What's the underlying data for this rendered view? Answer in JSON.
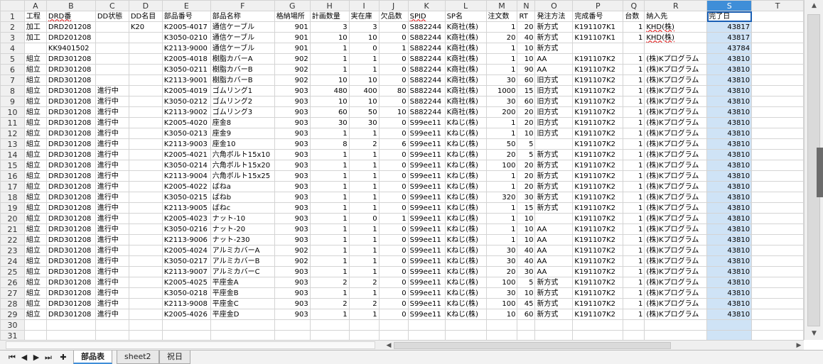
{
  "columns": [
    "A",
    "B",
    "C",
    "D",
    "E",
    "F",
    "G",
    "H",
    "I",
    "J",
    "K",
    "L",
    "M",
    "N",
    "O",
    "P",
    "Q",
    "R",
    "S",
    "T"
  ],
  "selected_column": "S",
  "header_row": [
    "工程",
    "DRD番",
    "DD状態",
    "DD名目",
    "部品番号",
    "部品名称",
    "格納場所",
    "計画数量",
    "実在庫",
    "欠品数",
    "SPID",
    "SP名",
    "注文数",
    "RT",
    "発注方法",
    "完成番号",
    "台数",
    "納入先",
    "完了日",
    ""
  ],
  "rows": [
    [
      "加工",
      "DRD201208",
      "",
      "K20",
      "K2005-4017",
      "通信ケーブル",
      "901",
      "3",
      "3",
      "0",
      "S882244",
      "K商社(株)",
      "1",
      "20",
      "新方式",
      "K191107K1",
      "1",
      "KHD(株)",
      "43817",
      ""
    ],
    [
      "加工",
      "DRD201208",
      "",
      "",
      "K3050-0210",
      "通信ケーブル",
      "901",
      "10",
      "10",
      "0",
      "S882244",
      "K商社(株)",
      "20",
      "40",
      "新方式",
      "K191107K1",
      "1",
      "KHD(株)",
      "43817",
      ""
    ],
    [
      "",
      "KK9401502",
      "",
      "",
      "K2113-9000",
      "通信ケーブル",
      "901",
      "1",
      "0",
      "1",
      "S882244",
      "K商社(株)",
      "1",
      "10",
      "新方式",
      "",
      "",
      "",
      "43784",
      ""
    ],
    [
      "組立",
      "DRD301208",
      "",
      "",
      "K2005-4018",
      "樹脂カバーA",
      "902",
      "1",
      "1",
      "0",
      "S882244",
      "K商社(株)",
      "1",
      "10",
      "AA",
      "K191107K2",
      "1",
      "(株)Kプログラム",
      "43810",
      ""
    ],
    [
      "組立",
      "DRD301208",
      "",
      "",
      "K3050-0211",
      "樹脂カバーB",
      "902",
      "1",
      "1",
      "0",
      "S882244",
      "K商社(株)",
      "1",
      "90",
      "AA",
      "K191107K2",
      "1",
      "(株)Kプログラム",
      "43810",
      ""
    ],
    [
      "組立",
      "DRD301208",
      "",
      "",
      "K2113-9001",
      "樹脂カバーB",
      "902",
      "10",
      "10",
      "0",
      "S882244",
      "K商社(株)",
      "30",
      "60",
      "旧方式",
      "K191107K2",
      "1",
      "(株)Kプログラム",
      "43810",
      ""
    ],
    [
      "組立",
      "DRD301208",
      "進行中",
      "",
      "K2005-4019",
      "ゴムリング1",
      "903",
      "480",
      "400",
      "80",
      "S882244",
      "K商社(株)",
      "1000",
      "15",
      "旧方式",
      "K191107K2",
      "1",
      "(株)Kプログラム",
      "43810",
      ""
    ],
    [
      "組立",
      "DRD301208",
      "進行中",
      "",
      "K3050-0212",
      "ゴムリング2",
      "903",
      "10",
      "10",
      "0",
      "S882244",
      "K商社(株)",
      "30",
      "60",
      "旧方式",
      "K191107K2",
      "1",
      "(株)Kプログラム",
      "43810",
      ""
    ],
    [
      "組立",
      "DRD301208",
      "進行中",
      "",
      "K2113-9002",
      "ゴムリング3",
      "903",
      "60",
      "50",
      "10",
      "S882244",
      "K商社(株)",
      "200",
      "20",
      "旧方式",
      "K191107K2",
      "1",
      "(株)Kプログラム",
      "43810",
      ""
    ],
    [
      "組立",
      "DRD301208",
      "進行中",
      "",
      "K2005-4020",
      "座金8",
      "903",
      "30",
      "30",
      "0",
      "S99ee11",
      "Kねじ(株)",
      "1",
      "20",
      "旧方式",
      "K191107K2",
      "1",
      "(株)Kプログラム",
      "43810",
      ""
    ],
    [
      "組立",
      "DRD301208",
      "進行中",
      "",
      "K3050-0213",
      "座金9",
      "903",
      "1",
      "1",
      "0",
      "S99ee11",
      "Kねじ(株)",
      "1",
      "10",
      "旧方式",
      "K191107K2",
      "1",
      "(株)Kプログラム",
      "43810",
      ""
    ],
    [
      "組立",
      "DRD301208",
      "進行中",
      "",
      "K2113-9003",
      "座金10",
      "903",
      "8",
      "2",
      "6",
      "S99ee11",
      "Kねじ(株)",
      "50",
      "5",
      "",
      "K191107K2",
      "1",
      "(株)Kプログラム",
      "43810",
      ""
    ],
    [
      "組立",
      "DRD301208",
      "進行中",
      "",
      "K2005-4021",
      "六角ボルト15x10",
      "903",
      "1",
      "1",
      "0",
      "S99ee11",
      "Kねじ(株)",
      "20",
      "5",
      "新方式",
      "K191107K2",
      "1",
      "(株)Kプログラム",
      "43810",
      ""
    ],
    [
      "組立",
      "DRD301208",
      "進行中",
      "",
      "K3050-0214",
      "六角ボルト15x20",
      "903",
      "1",
      "1",
      "0",
      "S99ee11",
      "Kねじ(株)",
      "100",
      "20",
      "新方式",
      "K191107K2",
      "1",
      "(株)Kプログラム",
      "43810",
      ""
    ],
    [
      "組立",
      "DRD301208",
      "進行中",
      "",
      "K2113-9004",
      "六角ボルト15x25",
      "903",
      "1",
      "1",
      "0",
      "S99ee11",
      "Kねじ(株)",
      "1",
      "20",
      "新方式",
      "K191107K2",
      "1",
      "(株)Kプログラム",
      "43810",
      ""
    ],
    [
      "組立",
      "DRD301208",
      "進行中",
      "",
      "K2005-4022",
      "ばねa",
      "903",
      "1",
      "1",
      "0",
      "S99ee11",
      "Kねじ(株)",
      "1",
      "20",
      "新方式",
      "K191107K2",
      "1",
      "(株)Kプログラム",
      "43810",
      ""
    ],
    [
      "組立",
      "DRD301208",
      "進行中",
      "",
      "K3050-0215",
      "ばねb",
      "903",
      "1",
      "1",
      "0",
      "S99ee11",
      "Kねじ(株)",
      "320",
      "30",
      "新方式",
      "K191107K2",
      "1",
      "(株)Kプログラム",
      "43810",
      ""
    ],
    [
      "組立",
      "DRD301208",
      "進行中",
      "",
      "K2113-9005",
      "ばねc",
      "903",
      "1",
      "1",
      "0",
      "S99ee11",
      "Kねじ(株)",
      "1",
      "15",
      "新方式",
      "K191107K2",
      "1",
      "(株)Kプログラム",
      "43810",
      ""
    ],
    [
      "組立",
      "DRD301208",
      "進行中",
      "",
      "K2005-4023",
      "ナット-10",
      "903",
      "1",
      "0",
      "1",
      "S99ee11",
      "Kねじ(株)",
      "1",
      "10",
      "",
      "K191107K2",
      "1",
      "(株)Kプログラム",
      "43810",
      ""
    ],
    [
      "組立",
      "DRD301208",
      "進行中",
      "",
      "K3050-0216",
      "ナット-20",
      "903",
      "1",
      "1",
      "0",
      "S99ee11",
      "Kねじ(株)",
      "1",
      "10",
      "AA",
      "K191107K2",
      "1",
      "(株)Kプログラム",
      "43810",
      ""
    ],
    [
      "組立",
      "DRD301208",
      "進行中",
      "",
      "K2113-9006",
      "ナット-230",
      "903",
      "1",
      "1",
      "0",
      "S99ee11",
      "Kねじ(株)",
      "1",
      "10",
      "AA",
      "K191107K2",
      "1",
      "(株)Kプログラム",
      "43810",
      ""
    ],
    [
      "組立",
      "DRD301208",
      "進行中",
      "",
      "K2005-4024",
      "アルミカバーA",
      "902",
      "1",
      "1",
      "0",
      "S99ee11",
      "Kねじ(株)",
      "30",
      "40",
      "AA",
      "K191107K2",
      "1",
      "(株)Kプログラム",
      "43810",
      ""
    ],
    [
      "組立",
      "DRD301208",
      "進行中",
      "",
      "K3050-0217",
      "アルミカバーB",
      "902",
      "1",
      "1",
      "0",
      "S99ee11",
      "Kねじ(株)",
      "30",
      "40",
      "AA",
      "K191107K2",
      "1",
      "(株)Kプログラム",
      "43810",
      ""
    ],
    [
      "組立",
      "DRD301208",
      "進行中",
      "",
      "K2113-9007",
      "アルミカバーC",
      "903",
      "1",
      "1",
      "0",
      "S99ee11",
      "Kねじ(株)",
      "20",
      "30",
      "AA",
      "K191107K2",
      "1",
      "(株)Kプログラム",
      "43810",
      ""
    ],
    [
      "組立",
      "DRD301208",
      "進行中",
      "",
      "K2005-4025",
      "平座金A",
      "903",
      "2",
      "2",
      "0",
      "S99ee11",
      "Kねじ(株)",
      "100",
      "5",
      "新方式",
      "K191107K2",
      "1",
      "(株)Kプログラム",
      "43810",
      ""
    ],
    [
      "組立",
      "DRD301208",
      "進行中",
      "",
      "K3050-0218",
      "平座金B",
      "903",
      "1",
      "1",
      "0",
      "S99ee11",
      "Kねじ(株)",
      "30",
      "10",
      "新方式",
      "K191107K2",
      "1",
      "(株)Kプログラム",
      "43810",
      ""
    ],
    [
      "組立",
      "DRD301208",
      "進行中",
      "",
      "K2113-9008",
      "平座金C",
      "903",
      "2",
      "2",
      "0",
      "S99ee11",
      "Kねじ(株)",
      "100",
      "45",
      "新方式",
      "K191107K2",
      "1",
      "(株)Kプログラム",
      "43810",
      ""
    ],
    [
      "組立",
      "DRD301208",
      "進行中",
      "",
      "K2005-4026",
      "平座金D",
      "903",
      "1",
      "1",
      "0",
      "S99ee11",
      "Kねじ(株)",
      "10",
      "60",
      "新方式",
      "K191107K2",
      "1",
      "(株)Kプログラム",
      "43810",
      ""
    ]
  ],
  "total_rows": 31,
  "sheet_tabs": [
    {
      "label": "部品表",
      "active": true
    },
    {
      "label": "sheet2",
      "active": false
    },
    {
      "label": "祝日",
      "active": false
    }
  ],
  "nav_buttons": [
    "⏮",
    "◀",
    "▶",
    "⏭",
    "✚"
  ],
  "scroll_glyphs": {
    "up": "▲",
    "down": "▼",
    "left": "◀",
    "right": "▶"
  }
}
